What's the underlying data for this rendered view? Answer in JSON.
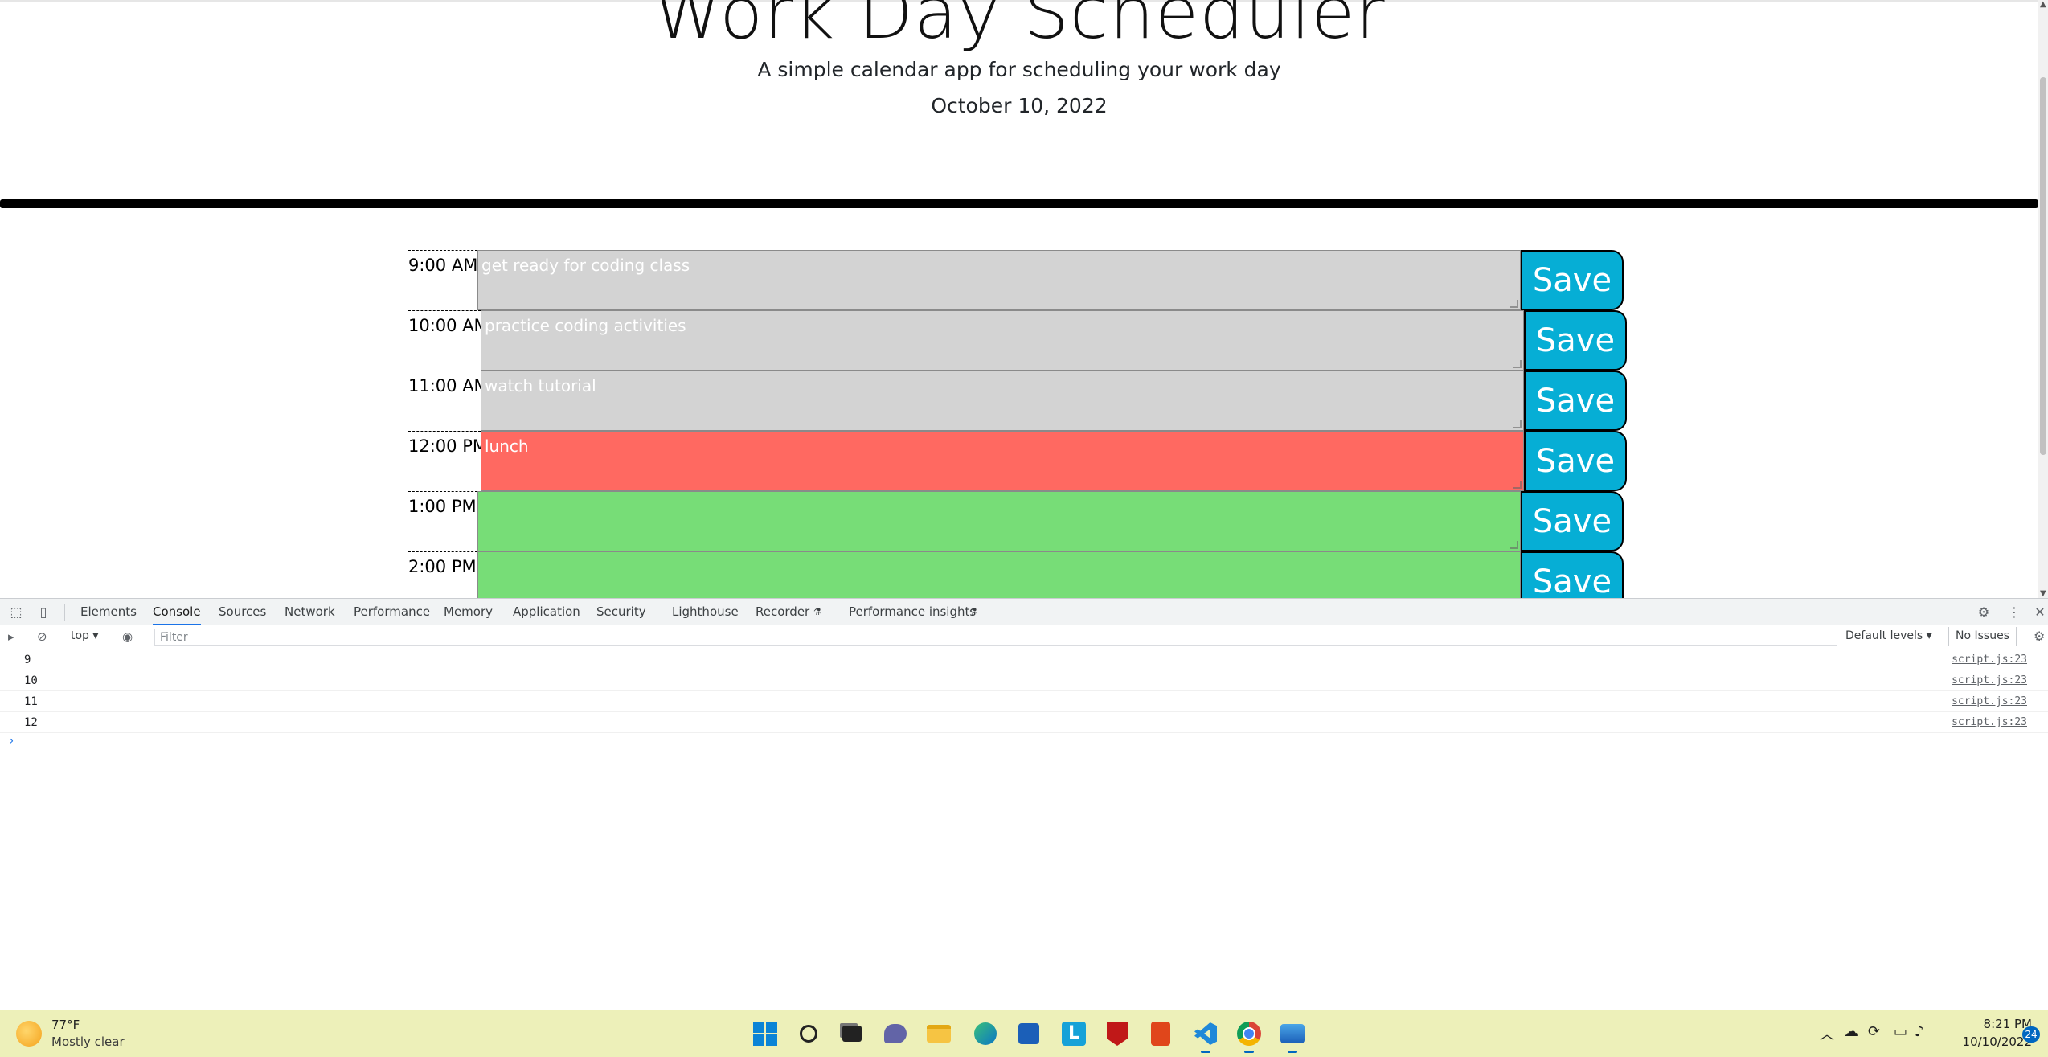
{
  "page": {
    "title": "Work Day Scheduler",
    "lead": "A simple calendar app for scheduling your work day",
    "current_day": "October 10, 2022"
  },
  "colors": {
    "past": "#d3d3d3",
    "present": "#ff6961",
    "future": "#77dd77",
    "save_button": "#06aed5"
  },
  "rows": [
    {
      "hour": "9:00 AM",
      "text": "get ready for coding class",
      "state": "past",
      "save_label": "Save"
    },
    {
      "hour": "10:00 AM",
      "text": "practice coding activities",
      "state": "past",
      "save_label": "Save"
    },
    {
      "hour": "11:00 AM",
      "text": "watch tutorial",
      "state": "past",
      "save_label": "Save"
    },
    {
      "hour": "12:00 PM",
      "text": "lunch",
      "state": "present",
      "save_label": "Save"
    },
    {
      "hour": "1:00 PM",
      "text": "",
      "state": "future",
      "save_label": "Save"
    },
    {
      "hour": "2:00 PM",
      "text": "",
      "state": "future",
      "save_label": "Save"
    }
  ],
  "devtools": {
    "tabs": [
      "Elements",
      "Console",
      "Sources",
      "Network",
      "Performance",
      "Memory",
      "Application",
      "Security",
      "Lighthouse",
      "Recorder",
      "Performance insights"
    ],
    "active_tab": "Console",
    "context": "top",
    "filter_placeholder": "Filter",
    "levels": "Default levels",
    "issues": "No Issues",
    "console_logs": [
      {
        "value": "9",
        "source": "script.js:23"
      },
      {
        "value": "10",
        "source": "script.js:23"
      },
      {
        "value": "11",
        "source": "script.js:23"
      },
      {
        "value": "12",
        "source": "script.js:23"
      }
    ],
    "prompt": "›"
  },
  "taskbar": {
    "weather_temp": "77°F",
    "weather_desc": "Mostly clear",
    "time": "8:21 PM",
    "date": "10/10/2022",
    "notification_count": "24",
    "apps": [
      "windows-start",
      "search",
      "task-view",
      "teams-chat",
      "file-explorer",
      "edge",
      "microsoft-store",
      "l-app",
      "mcafee",
      "office",
      "vs-code",
      "chrome",
      "photos"
    ]
  }
}
